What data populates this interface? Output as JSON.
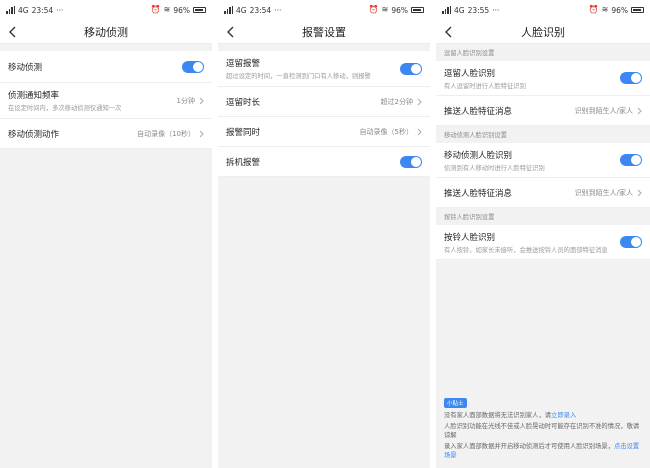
{
  "screens": [
    {
      "status": {
        "carrier": "4G",
        "time": "23:54",
        "extra": "···",
        "battery": "96%"
      },
      "title": "移动侦测",
      "rows": [
        {
          "label": "移动侦测"
        },
        {
          "label": "侦测通知频率",
          "desc": "在设定时间内，多次移动侦测仅通知一次",
          "value": "1分钟"
        },
        {
          "label": "移动侦测动作",
          "value": "自动录像（10秒）"
        }
      ]
    },
    {
      "status": {
        "carrier": "4G",
        "time": "23:54",
        "extra": "···",
        "battery": "96%"
      },
      "title": "报警设置",
      "rows": [
        {
          "label": "逗留报警",
          "desc": "超过设定的时间，一直检测到门口有人移动，则报警"
        },
        {
          "label": "逗留时长",
          "value": "超过2分钟"
        },
        {
          "label": "报警同时",
          "value": "自动录像（5秒）"
        },
        {
          "label": "拆机报警"
        }
      ]
    },
    {
      "status": {
        "carrier": "4G",
        "time": "23:55",
        "extra": "···",
        "battery": "96%"
      },
      "title": "人脸识别",
      "sections": [
        {
          "header": "逗留人脸识别设置",
          "toggle_label": "逗留人脸识别",
          "toggle_desc": "有人逗留时进行人脸特征识别",
          "push_label": "推送人脸特征消息",
          "push_value": "识别到陌生人/家人"
        },
        {
          "header": "移动侦测人脸识别设置",
          "toggle_label": "移动侦测人脸识别",
          "toggle_desc": "侦测到有人移动时进行人脸特征识别",
          "push_label": "推送人脸特征消息",
          "push_value": "识别到陌生人/家人"
        },
        {
          "header": "按铃人脸识别设置",
          "toggle_label": "按铃人脸识别",
          "toggle_desc": "有人按铃，如家长未接听，会推送按铃人员的面部特征消息"
        }
      ],
      "tips": {
        "badge": "小贴士",
        "line1_text": "没有家人面部数据将无法识别家人，请",
        "line1_link": "立即录入",
        "line2": "人脸识别功能在光线不佳或人脸晃动时可能存在识别不准的情况，敬请谅解",
        "line3_text": "录入家人面部数据并开启移动侦测后才可使用人脸识别场景，",
        "line3_link": "点击设置场景"
      }
    }
  ],
  "colors": {
    "accent": "#3d88f0",
    "background": "#f2f2f2"
  },
  "icons": {
    "back": "chevron-left-icon",
    "more": "chevron-right-icon",
    "toggle": "toggle-on"
  }
}
